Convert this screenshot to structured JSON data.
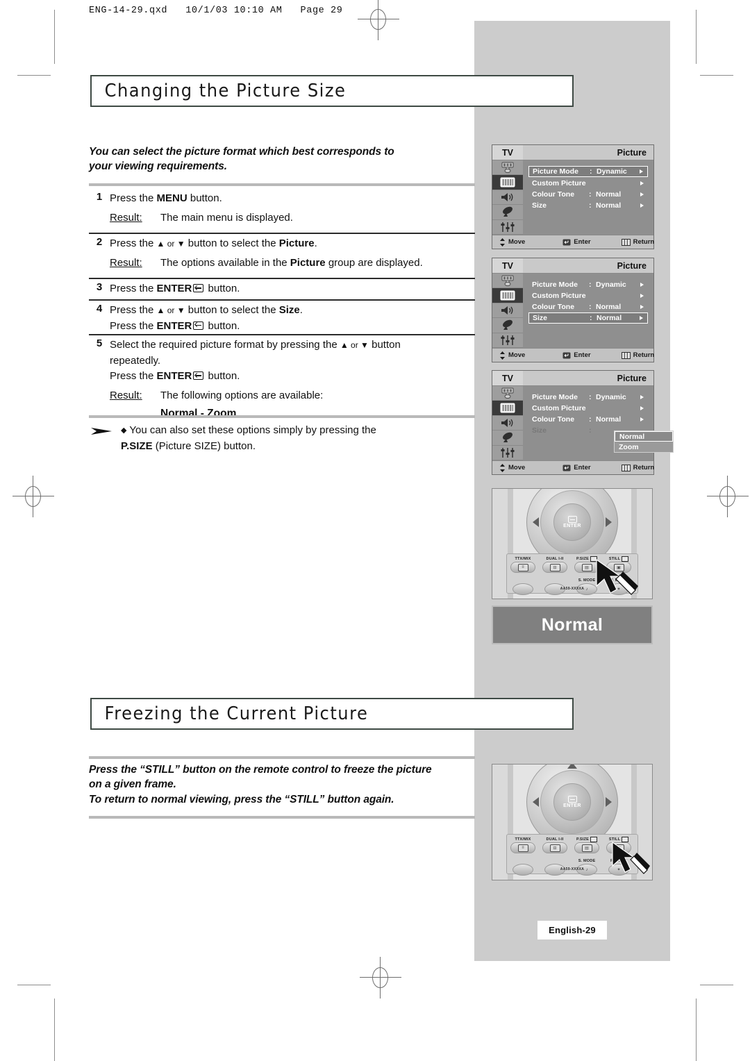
{
  "print_header": "ENG-14-29.qxd   10/1/03 10:10 AM   Page 29",
  "sections": [
    {
      "title": "Changing the Picture Size"
    },
    {
      "title": "Freezing the Current Picture"
    }
  ],
  "intro": {
    "line1": "You can select the picture format which best corresponds to",
    "line2": "your viewing requirements."
  },
  "steps": [
    {
      "num": "1",
      "line1_a": "Press the ",
      "line1_b": "MENU",
      "line1_c": " button.",
      "result_label": "Result:",
      "result_text": "The main menu is displayed."
    },
    {
      "num": "2",
      "line1_a": "Press the ",
      "line1_arrows": "▲ or ▼",
      "line1_c": " button to select the ",
      "line1_bold": "Picture",
      "line1_d": ".",
      "result_label": "Result:",
      "result_a": "The options available in the ",
      "result_bold": "Picture",
      "result_b": " group are displayed."
    },
    {
      "num": "3",
      "line1_a": "Press the ",
      "line1_bold": "ENTER",
      "line1_c": " button."
    },
    {
      "num": "4",
      "line1_a": "Press the ",
      "line1_arrows": "▲ or ▼",
      "line1_c": " button to select the ",
      "line1_bold": "Size",
      "line1_d": ".",
      "line2_a": "Press the ",
      "line2_bold": "ENTER",
      "line2_c": " button."
    },
    {
      "num": "5",
      "line1_a": "Select the required picture format by pressing the ",
      "line1_arrows": "▲ or ▼",
      "line1_c": " button",
      "line2": "repeatedly.",
      "line3_a": "Press the ",
      "line3_bold": "ENTER",
      "line3_c": " button.",
      "result_label": "Result:",
      "result_text": "The following options are available:",
      "options": "Normal - Zoom"
    }
  ],
  "note": {
    "bullet": "◆",
    "line1": "You can also set these options simply by pressing the",
    "line2_bold": "P.SIZE",
    "line2_rest": " (Picture SIZE) button."
  },
  "freeze": {
    "line1": "Press the “STILL” button on the remote control to freeze the picture",
    "line2": "on a given frame.",
    "line3": "To return to normal viewing, press the “STILL” button again."
  },
  "osd": {
    "tv_label": "TV",
    "title": "Picture",
    "bottom": {
      "move": "Move",
      "enter": "Enter",
      "return": "Return"
    },
    "rows": [
      {
        "label": "Picture Mode",
        "colon": ":",
        "value": "Dynamic",
        "arrow": true
      },
      {
        "label": "Custom Picture",
        "colon": "",
        "value": "",
        "arrow": true
      },
      {
        "label": "Colour Tone",
        "colon": ":",
        "value": "Normal",
        "arrow": true
      },
      {
        "label": "Size",
        "colon": ":",
        "value": "Normal",
        "arrow": true
      }
    ],
    "popup": {
      "selected": "Normal",
      "other": "Zoom"
    },
    "screens": [
      {
        "highlight_index": 0
      },
      {
        "highlight_index": 3
      },
      {
        "highlight_index": -1,
        "popup": true
      }
    ]
  },
  "remote": {
    "enter_label": "ENTER",
    "model": "AA59-XXXXA",
    "row1": [
      {
        "label": "TTX/MIX",
        "glyph": false
      },
      {
        "label": "DUAL I-II",
        "glyph": false
      },
      {
        "label": "P.SIZE",
        "glyph": true
      },
      {
        "label": "STILL",
        "glyph": true
      }
    ],
    "row2": [
      {
        "label": ""
      },
      {
        "label": ""
      },
      {
        "label": "S. MODE"
      },
      {
        "label": "P. MODE"
      }
    ]
  },
  "caption": {
    "normal": "Normal"
  },
  "footer": {
    "page": "English-29"
  }
}
